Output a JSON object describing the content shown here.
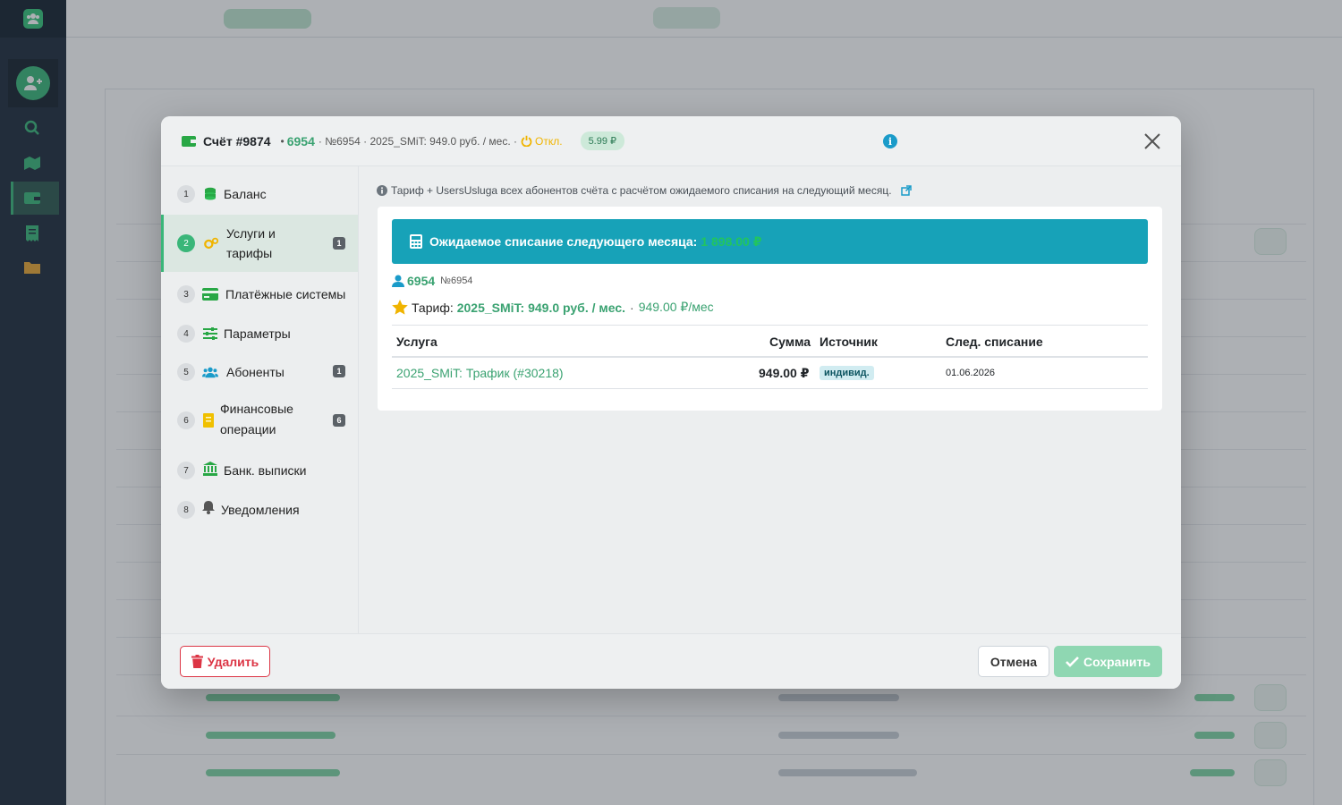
{
  "modal": {
    "title": "Счёт #9874",
    "separator": "•",
    "account_number": "6954",
    "account_meta": "· №6954 · 2025_SMiT: 949.0 руб. / мес. ·",
    "status": "Откл.",
    "price_badge": "5.99 ₽",
    "info_glyph": "i"
  },
  "nav": {
    "items": [
      {
        "num": "1",
        "label": "Баланс",
        "icon": "coins-icon",
        "badge": ""
      },
      {
        "num": "2",
        "label": "Услуги и",
        "label2": "тарифы",
        "icon": "gears-icon",
        "badge": "1"
      },
      {
        "num": "3",
        "label": "Платёжные системы",
        "icon": "credit-card-icon",
        "badge": ""
      },
      {
        "num": "4",
        "label": "Параметры",
        "icon": "sliders-icon",
        "badge": ""
      },
      {
        "num": "5",
        "label": "Абоненты",
        "icon": "users-icon",
        "badge": "1"
      },
      {
        "num": "6",
        "label": "Финансовые",
        "label2": "операции",
        "icon": "receipt-icon",
        "badge": "6"
      },
      {
        "num": "7",
        "label": "Банк. выписки",
        "icon": "bank-icon",
        "badge": ""
      },
      {
        "num": "8",
        "label": "Уведомления",
        "icon": "bell-icon",
        "badge": ""
      }
    ]
  },
  "body": {
    "hint": "Тариф + UsersUsluga всех абонентов счёта с расчётом ожидаемого списания на следующий месяц.",
    "expected_label": "Ожидаемое списание следующего месяца:",
    "expected_amount": "1 898.00 ₽",
    "account_number": "6954",
    "account_sub": "№6954",
    "tariff_label": "Тариф:",
    "tariff_name": "2025_SMiT: 949.0 руб. / мес.",
    "tariff_dot": "·",
    "tariff_price": "949.00 ₽/мес",
    "table": {
      "headers": [
        "Услуга",
        "Сумма",
        "Источник",
        "След. списание"
      ],
      "rows": [
        {
          "service": "2025_SMiT: Трафик (#30218)",
          "sum": "949.00 ₽",
          "source": "индивид.",
          "next": "01.06.2026"
        }
      ]
    }
  },
  "footer": {
    "delete_label": "Удалить",
    "cancel_label": "Отмена",
    "save_label": "Сохранить"
  },
  "colors": {
    "accent_green": "#3ab679",
    "teal": "#17a2b8",
    "danger": "#dc3545",
    "warning": "#f0b400"
  }
}
